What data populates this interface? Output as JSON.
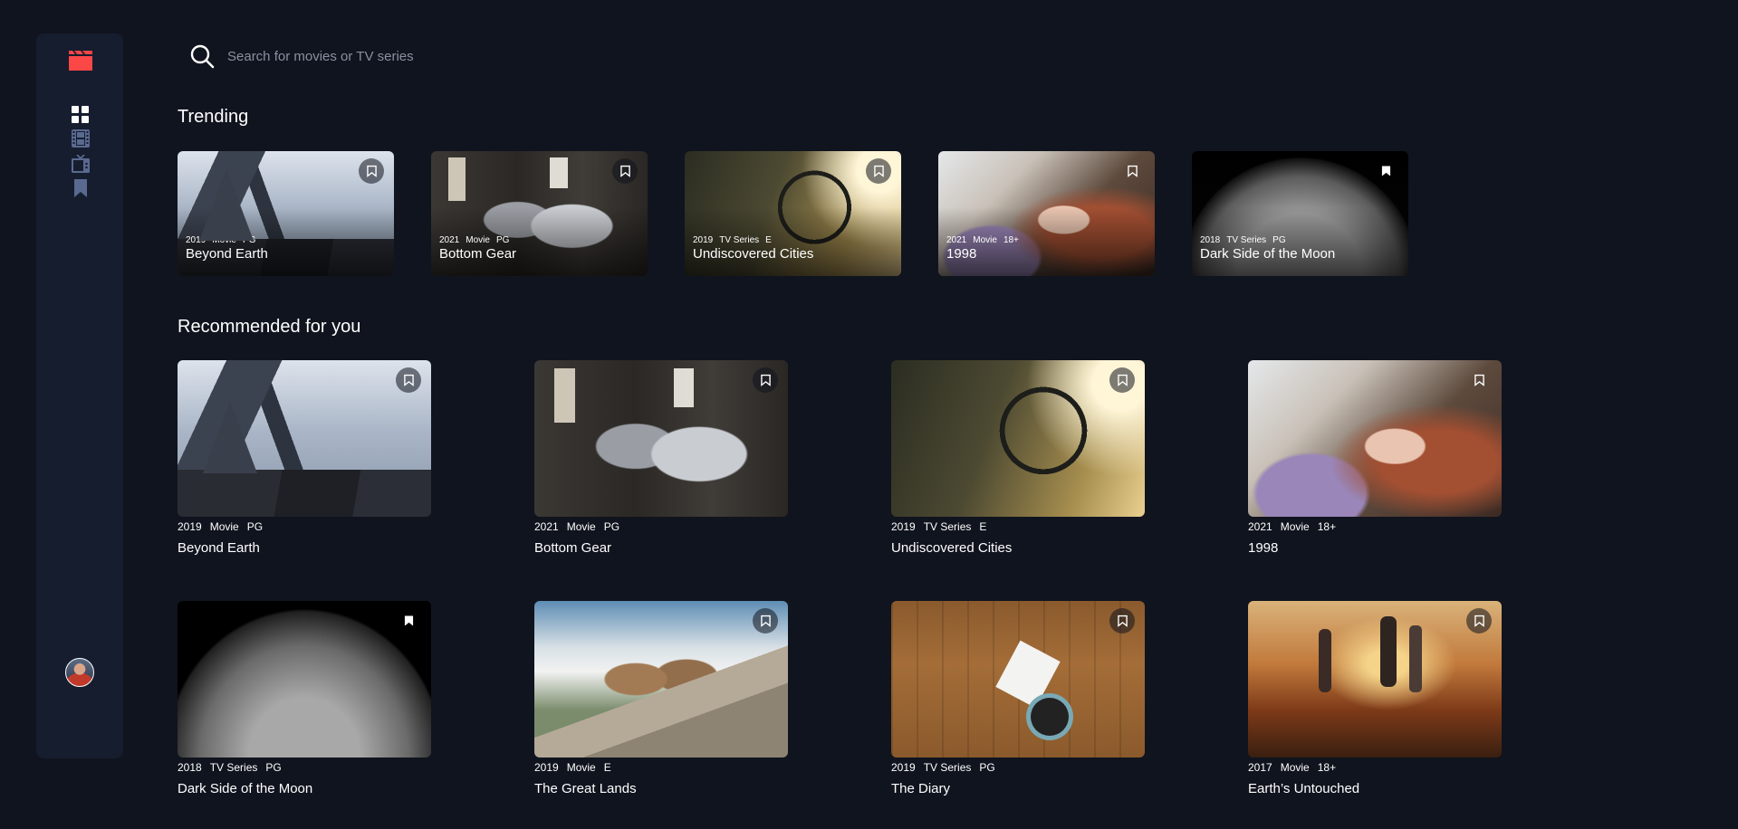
{
  "app": {
    "accent_color": "#fc4747",
    "background_color": "#10141e",
    "sidebar_color": "#161d2f"
  },
  "sidebar": {
    "logo_icon": "film-clapper-icon",
    "nav": [
      {
        "name": "home",
        "icon": "grid-icon",
        "active": true
      },
      {
        "name": "movies",
        "icon": "film-icon"
      },
      {
        "name": "tv-series",
        "icon": "tv-icon"
      },
      {
        "name": "bookmarks",
        "icon": "bookmark-icon"
      }
    ],
    "avatar_icon": "user-avatar"
  },
  "search": {
    "placeholder": "Search for movies or TV series",
    "value": ""
  },
  "trending": {
    "heading": "Trending",
    "items": [
      {
        "year": "2019",
        "category": "Movie",
        "rating": "PG",
        "title": "Beyond Earth",
        "bookmarked": false
      },
      {
        "year": "2021",
        "category": "Movie",
        "rating": "PG",
        "title": "Bottom Gear",
        "bookmarked": false
      },
      {
        "year": "2019",
        "category": "TV Series",
        "rating": "E",
        "title": "Undiscovered Cities",
        "bookmarked": false
      },
      {
        "year": "2021",
        "category": "Movie",
        "rating": "18+",
        "title": "1998",
        "bookmarked": false
      },
      {
        "year": "2018",
        "category": "TV Series",
        "rating": "PG",
        "title": "Dark Side of the Moon",
        "bookmarked": true
      }
    ]
  },
  "recommended": {
    "heading": "Recommended for you",
    "items": [
      {
        "year": "2019",
        "category": "Movie",
        "rating": "PG",
        "title": "Beyond Earth",
        "bookmarked": false
      },
      {
        "year": "2021",
        "category": "Movie",
        "rating": "PG",
        "title": "Bottom Gear",
        "bookmarked": false
      },
      {
        "year": "2019",
        "category": "TV Series",
        "rating": "E",
        "title": "Undiscovered Cities",
        "bookmarked": false
      },
      {
        "year": "2021",
        "category": "Movie",
        "rating": "18+",
        "title": "1998",
        "bookmarked": false
      },
      {
        "year": "2018",
        "category": "TV Series",
        "rating": "PG",
        "title": "Dark Side of the Moon",
        "bookmarked": true
      },
      {
        "year": "2019",
        "category": "Movie",
        "rating": "E",
        "title": "The Great Lands",
        "bookmarked": false
      },
      {
        "year": "2019",
        "category": "TV Series",
        "rating": "PG",
        "title": "The Diary",
        "bookmarked": false
      },
      {
        "year": "2017",
        "category": "Movie",
        "rating": "18+",
        "title": "Earth’s Untouched",
        "bookmarked": false
      }
    ]
  }
}
